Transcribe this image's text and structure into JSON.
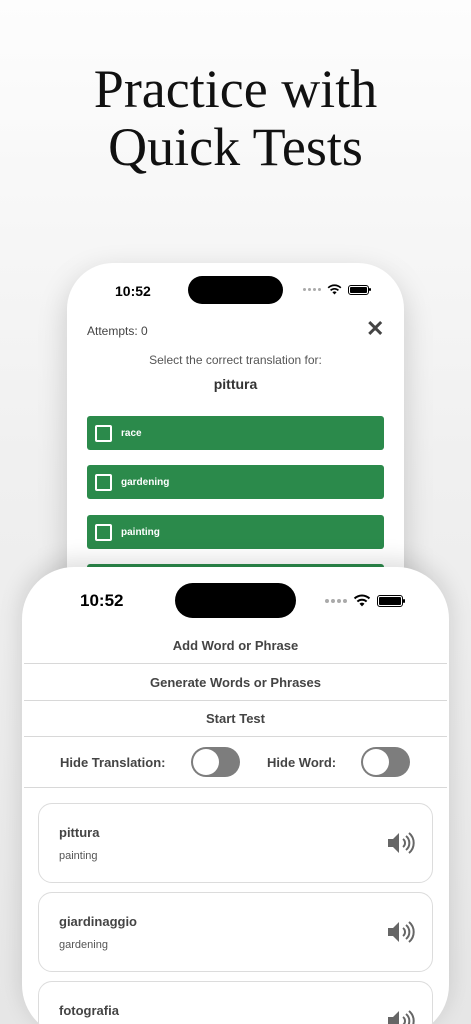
{
  "headline": {
    "line1": "Practice with",
    "line2": "Quick Tests"
  },
  "quiz_screen": {
    "status_time": "10:52",
    "attempts": "Attempts: 0",
    "close_icon": "close-icon",
    "prompt": "Select the correct translation for:",
    "word": "pittura",
    "options": [
      {
        "label": "race"
      },
      {
        "label": "gardening"
      },
      {
        "label": "painting"
      }
    ],
    "option_color": "#2b8a4b"
  },
  "list_screen": {
    "status_time": "10:52",
    "add_word": "Add Word or Phrase",
    "generate": "Generate Words or Phrases",
    "start_test": "Start Test",
    "hide_translation": "Hide Translation:",
    "hide_word": "Hide Word:",
    "words": [
      {
        "word": "pittura",
        "translation": "painting"
      },
      {
        "word": "giardinaggio",
        "translation": "gardening"
      },
      {
        "word": "fotografia",
        "translation": ""
      }
    ],
    "speaker_icon": "speaker-icon"
  }
}
